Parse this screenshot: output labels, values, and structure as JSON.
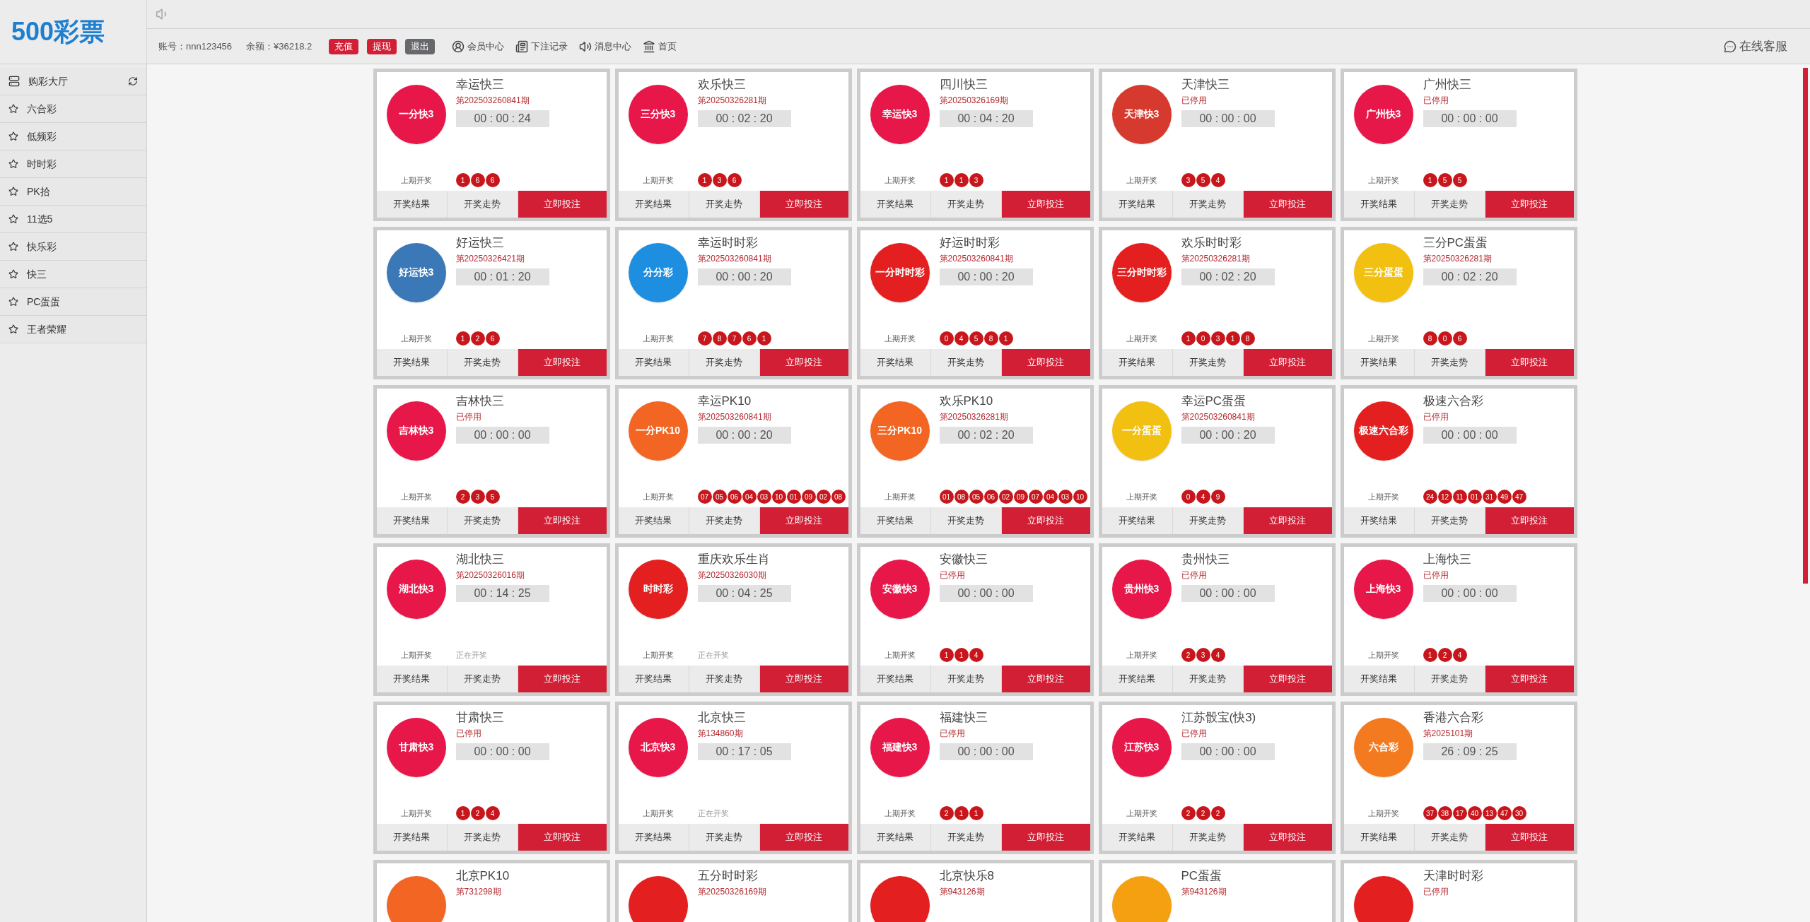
{
  "logo": {
    "text": "500彩票"
  },
  "header": {
    "account": "账号：nnn123456",
    "balance": "余额：¥36218.2",
    "buttons": [
      {
        "label": "充值",
        "kind": "primary"
      },
      {
        "label": "提现",
        "kind": "primary"
      },
      {
        "label": "退出",
        "kind": "secondary"
      }
    ],
    "links": [
      {
        "label": "会员中心",
        "kind": "user"
      },
      {
        "label": "下注记录",
        "kind": "records"
      },
      {
        "label": "消息中心",
        "kind": "messages"
      },
      {
        "label": "首页",
        "kind": "home"
      }
    ],
    "support": "在线客服"
  },
  "sidebar": {
    "title": "购彩大厅",
    "items": [
      "六合彩",
      "低频彩",
      "时时彩",
      "PK拾",
      "11选5",
      "快乐彩",
      "快三",
      "PC蛋蛋",
      "王者荣耀"
    ]
  },
  "games": [
    {
      "name": "幸运快三",
      "issue": "第202503260841期",
      "timer": "00 : 00 : 24",
      "logo": {
        "text": "一分快3",
        "color": "#e8174a"
      },
      "last_label": "上期开奖",
      "balls": [
        "1",
        "6",
        "6"
      ],
      "buttons": [
        "开奖结果",
        "开奖走势",
        "立即投注"
      ]
    },
    {
      "name": "欢乐快三",
      "issue": "第20250326281期",
      "timer": "00 : 02 : 20",
      "logo": {
        "text": "三分快3",
        "color": "#e8174a"
      },
      "last_label": "上期开奖",
      "balls": [
        "1",
        "3",
        "6"
      ],
      "buttons": [
        "开奖结果",
        "开奖走势",
        "立即投注"
      ]
    },
    {
      "name": "四川快三",
      "issue": "第20250326169期",
      "timer": "00 : 04 : 20",
      "logo": {
        "text": "幸运快3",
        "color": "#e8174a"
      },
      "last_label": "上期开奖",
      "balls": [
        "1",
        "1",
        "3"
      ],
      "buttons": [
        "开奖结果",
        "开奖走势",
        "立即投注"
      ]
    },
    {
      "name": "天津快三",
      "issue": "已停用",
      "timer": "00 : 00 : 00",
      "logo": {
        "text": "天津快3",
        "color": "#d63a2e"
      },
      "last_label": "上期开奖",
      "balls": [
        "3",
        "5",
        "4"
      ],
      "buttons": [
        "开奖结果",
        "开奖走势",
        "立即投注"
      ]
    },
    {
      "name": "广州快三",
      "issue": "已停用",
      "timer": "00 : 00 : 00",
      "logo": {
        "text": "广州快3",
        "color": "#e8174a"
      },
      "last_label": "上期开奖",
      "balls": [
        "1",
        "5",
        "5"
      ],
      "buttons": [
        "开奖结果",
        "开奖走势",
        "立即投注"
      ]
    },
    {
      "name": "好运快三",
      "issue": "第20250326421期",
      "timer": "00 : 01 : 20",
      "logo": {
        "text": "好运快3",
        "color": "#3a78b8"
      },
      "last_label": "上期开奖",
      "balls": [
        "1",
        "2",
        "6"
      ],
      "buttons": [
        "开奖结果",
        "开奖走势",
        "立即投注"
      ]
    },
    {
      "name": "幸运时时彩",
      "issue": "第202503260841期",
      "timer": "00 : 00 : 20",
      "logo": {
        "text": "分分彩",
        "color": "#1e8fe0"
      },
      "last_label": "上期开奖",
      "balls": [
        "7",
        "8",
        "7",
        "6",
        "1"
      ],
      "buttons": [
        "开奖结果",
        "开奖走势",
        "立即投注"
      ]
    },
    {
      "name": "好运时时彩",
      "issue": "第202503260841期",
      "timer": "00 : 00 : 20",
      "logo": {
        "text": "一分时时彩",
        "color": "#e3201f"
      },
      "last_label": "上期开奖",
      "balls": [
        "0",
        "4",
        "5",
        "8",
        "1"
      ],
      "buttons": [
        "开奖结果",
        "开奖走势",
        "立即投注"
      ]
    },
    {
      "name": "欢乐时时彩",
      "issue": "第20250326281期",
      "timer": "00 : 02 : 20",
      "logo": {
        "text": "三分时时彩",
        "color": "#e3201f"
      },
      "last_label": "上期开奖",
      "balls": [
        "1",
        "0",
        "3",
        "1",
        "8"
      ],
      "buttons": [
        "开奖结果",
        "开奖走势",
        "立即投注"
      ]
    },
    {
      "name": "三分PC蛋蛋",
      "issue": "第20250326281期",
      "timer": "00 : 02 : 20",
      "logo": {
        "text": "三分蛋蛋",
        "color": "#f2c010"
      },
      "last_label": "上期开奖",
      "balls": [
        "8",
        "0",
        "6"
      ],
      "buttons": [
        "开奖结果",
        "开奖走势",
        "立即投注"
      ]
    },
    {
      "name": "吉林快三",
      "issue": "已停用",
      "timer": "00 : 00 : 00",
      "logo": {
        "text": "吉林快3",
        "color": "#e8174a"
      },
      "last_label": "上期开奖",
      "balls": [
        "2",
        "3",
        "5"
      ],
      "buttons": [
        "开奖结果",
        "开奖走势",
        "立即投注"
      ]
    },
    {
      "name": "幸运PK10",
      "issue": "第202503260841期",
      "timer": "00 : 00 : 20",
      "logo": {
        "text": "一分PK10",
        "color": "#f26522"
      },
      "last_label": "上期开奖",
      "balls": [
        "07",
        "05",
        "06",
        "04",
        "03",
        "10",
        "01",
        "09",
        "02",
        "08"
      ],
      "buttons": [
        "开奖结果",
        "开奖走势",
        "立即投注"
      ]
    },
    {
      "name": "欢乐PK10",
      "issue": "第20250326281期",
      "timer": "00 : 02 : 20",
      "logo": {
        "text": "三分PK10",
        "color": "#f26522"
      },
      "last_label": "上期开奖",
      "balls": [
        "01",
        "08",
        "05",
        "06",
        "02",
        "09",
        "07",
        "04",
        "03",
        "10"
      ],
      "buttons": [
        "开奖结果",
        "开奖走势",
        "立即投注"
      ]
    },
    {
      "name": "幸运PC蛋蛋",
      "issue": "第202503260841期",
      "timer": "00 : 00 : 20",
      "logo": {
        "text": "一分蛋蛋",
        "color": "#f2c010"
      },
      "last_label": "上期开奖",
      "balls": [
        "0",
        "4",
        "9"
      ],
      "buttons": [
        "开奖结果",
        "开奖走势",
        "立即投注"
      ]
    },
    {
      "name": "极速六合彩",
      "issue": "已停用",
      "timer": "00 : 00 : 00",
      "logo": {
        "text": "极速六合彩",
        "color": "#e3201f"
      },
      "last_label": "上期开奖",
      "balls": [
        "24",
        "12",
        "11",
        "01",
        "31",
        "49",
        "47"
      ],
      "buttons": [
        "开奖结果",
        "开奖走势",
        "立即投注"
      ]
    },
    {
      "name": "湖北快三",
      "issue": "第20250326016期",
      "timer": "00 : 14 : 25",
      "logo": {
        "text": "湖北快3",
        "color": "#e8174a"
      },
      "last_label": "上期开奖",
      "status": "正在开奖",
      "buttons": [
        "开奖结果",
        "开奖走势",
        "立即投注"
      ]
    },
    {
      "name": "重庆欢乐生肖",
      "issue": "第20250326030期",
      "timer": "00 : 04 : 25",
      "logo": {
        "text": "时时彩",
        "color": "#e3201f"
      },
      "last_label": "上期开奖",
      "status": "正在开奖",
      "buttons": [
        "开奖结果",
        "开奖走势",
        "立即投注"
      ]
    },
    {
      "name": "安徽快三",
      "issue": "已停用",
      "timer": "00 : 00 : 00",
      "logo": {
        "text": "安徽快3",
        "color": "#e8174a"
      },
      "last_label": "上期开奖",
      "balls": [
        "1",
        "1",
        "4"
      ],
      "buttons": [
        "开奖结果",
        "开奖走势",
        "立即投注"
      ]
    },
    {
      "name": "贵州快三",
      "issue": "已停用",
      "timer": "00 : 00 : 00",
      "logo": {
        "text": "贵州快3",
        "color": "#e8174a"
      },
      "last_label": "上期开奖",
      "balls": [
        "2",
        "3",
        "4"
      ],
      "buttons": [
        "开奖结果",
        "开奖走势",
        "立即投注"
      ]
    },
    {
      "name": "上海快三",
      "issue": "已停用",
      "timer": "00 : 00 : 00",
      "logo": {
        "text": "上海快3",
        "color": "#e8174a"
      },
      "last_label": "上期开奖",
      "balls": [
        "1",
        "2",
        "4"
      ],
      "buttons": [
        "开奖结果",
        "开奖走势",
        "立即投注"
      ]
    },
    {
      "name": "甘肃快三",
      "issue": "已停用",
      "timer": "00 : 00 : 00",
      "logo": {
        "text": "甘肃快3",
        "color": "#e8174a"
      },
      "last_label": "上期开奖",
      "balls": [
        "1",
        "2",
        "4"
      ],
      "buttons": [
        "开奖结果",
        "开奖走势",
        "立即投注"
      ]
    },
    {
      "name": "北京快三",
      "issue": "第134860期",
      "timer": "00 : 17 : 05",
      "logo": {
        "text": "北京快3",
        "color": "#e8174a"
      },
      "last_label": "上期开奖",
      "status": "正在开奖",
      "buttons": [
        "开奖结果",
        "开奖走势",
        "立即投注"
      ]
    },
    {
      "name": "福建快三",
      "issue": "已停用",
      "timer": "00 : 00 : 00",
      "logo": {
        "text": "福建快3",
        "color": "#e8174a"
      },
      "last_label": "上期开奖",
      "balls": [
        "2",
        "1",
        "1"
      ],
      "buttons": [
        "开奖结果",
        "开奖走势",
        "立即投注"
      ]
    },
    {
      "name": "江苏骰宝(快3)",
      "issue": "已停用",
      "timer": "00 : 00 : 00",
      "logo": {
        "text": "江苏快3",
        "color": "#e8174a"
      },
      "last_label": "上期开奖",
      "balls": [
        "2",
        "2",
        "2"
      ],
      "buttons": [
        "开奖结果",
        "开奖走势",
        "立即投注"
      ]
    },
    {
      "name": "香港六合彩",
      "issue": "第2025101期",
      "timer": "26 : 09 : 25",
      "logo": {
        "text": "六合彩",
        "color": "#f47a20"
      },
      "last_label": "上期开奖",
      "balls": [
        "37",
        "38",
        "17",
        "40",
        "13",
        "47",
        "30"
      ],
      "buttons": [
        "开奖结果",
        "开奖走势",
        "立即投注"
      ]
    },
    {
      "name": "北京PK10",
      "issue": "第731298期",
      "logo": {
        "color": "#f26522"
      }
    },
    {
      "name": "五分时时彩",
      "issue": "第20250326169期",
      "logo": {
        "color": "#e3201f"
      }
    },
    {
      "name": "北京快乐8",
      "issue": "第943126期",
      "logo": {
        "color": "#e3201f"
      }
    },
    {
      "name": "PC蛋蛋",
      "issue": "第943126期",
      "logo": {
        "color": "#f5a010"
      }
    },
    {
      "name": "天津时时彩",
      "issue": "已停用",
      "logo": {
        "color": "#e3201f"
      }
    }
  ]
}
